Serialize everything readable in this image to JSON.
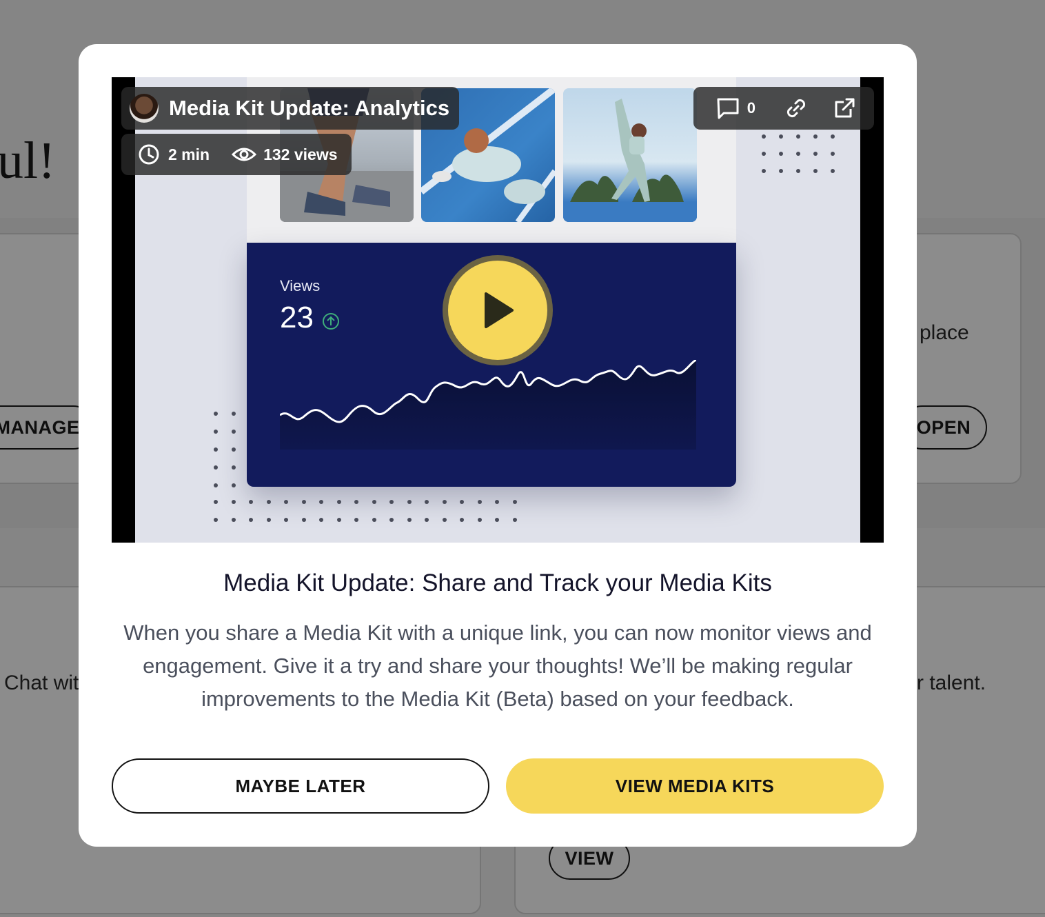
{
  "background": {
    "heading_fragment": "ul!",
    "manage_button": "MANAGE",
    "open_button": "OPEN",
    "view_button": "VIEW",
    "text_place": "place",
    "text_chat": "Chat wit",
    "text_talent": "r talent."
  },
  "modal": {
    "video": {
      "title": "Media Kit Update: Analytics",
      "duration": "2 min",
      "views": "132 views",
      "comment_count": "0",
      "dashboard_views_label": "Views",
      "dashboard_views_value": "23",
      "icons": [
        "avatar",
        "clock-icon",
        "eye-icon",
        "comment-icon",
        "link-icon",
        "external-link-icon",
        "play-icon",
        "arrow-up-icon"
      ]
    },
    "title": "Media Kit Update: Share and Track your Media Kits",
    "body": "When you share a Media Kit with a unique link, you can now monitor views and engagement. Give it a try and share your thoughts! We’ll be making regular improvements to the Media Kit (Beta) based on your feedback.",
    "maybe_later_label": "MAYBE LATER",
    "view_media_kits_label": "VIEW MEDIA KITS"
  },
  "colors": {
    "accent_yellow": "#f6d75a",
    "dashboard_navy": "#121b5c",
    "overlay": "rgba(0,0,0,0.45)"
  }
}
